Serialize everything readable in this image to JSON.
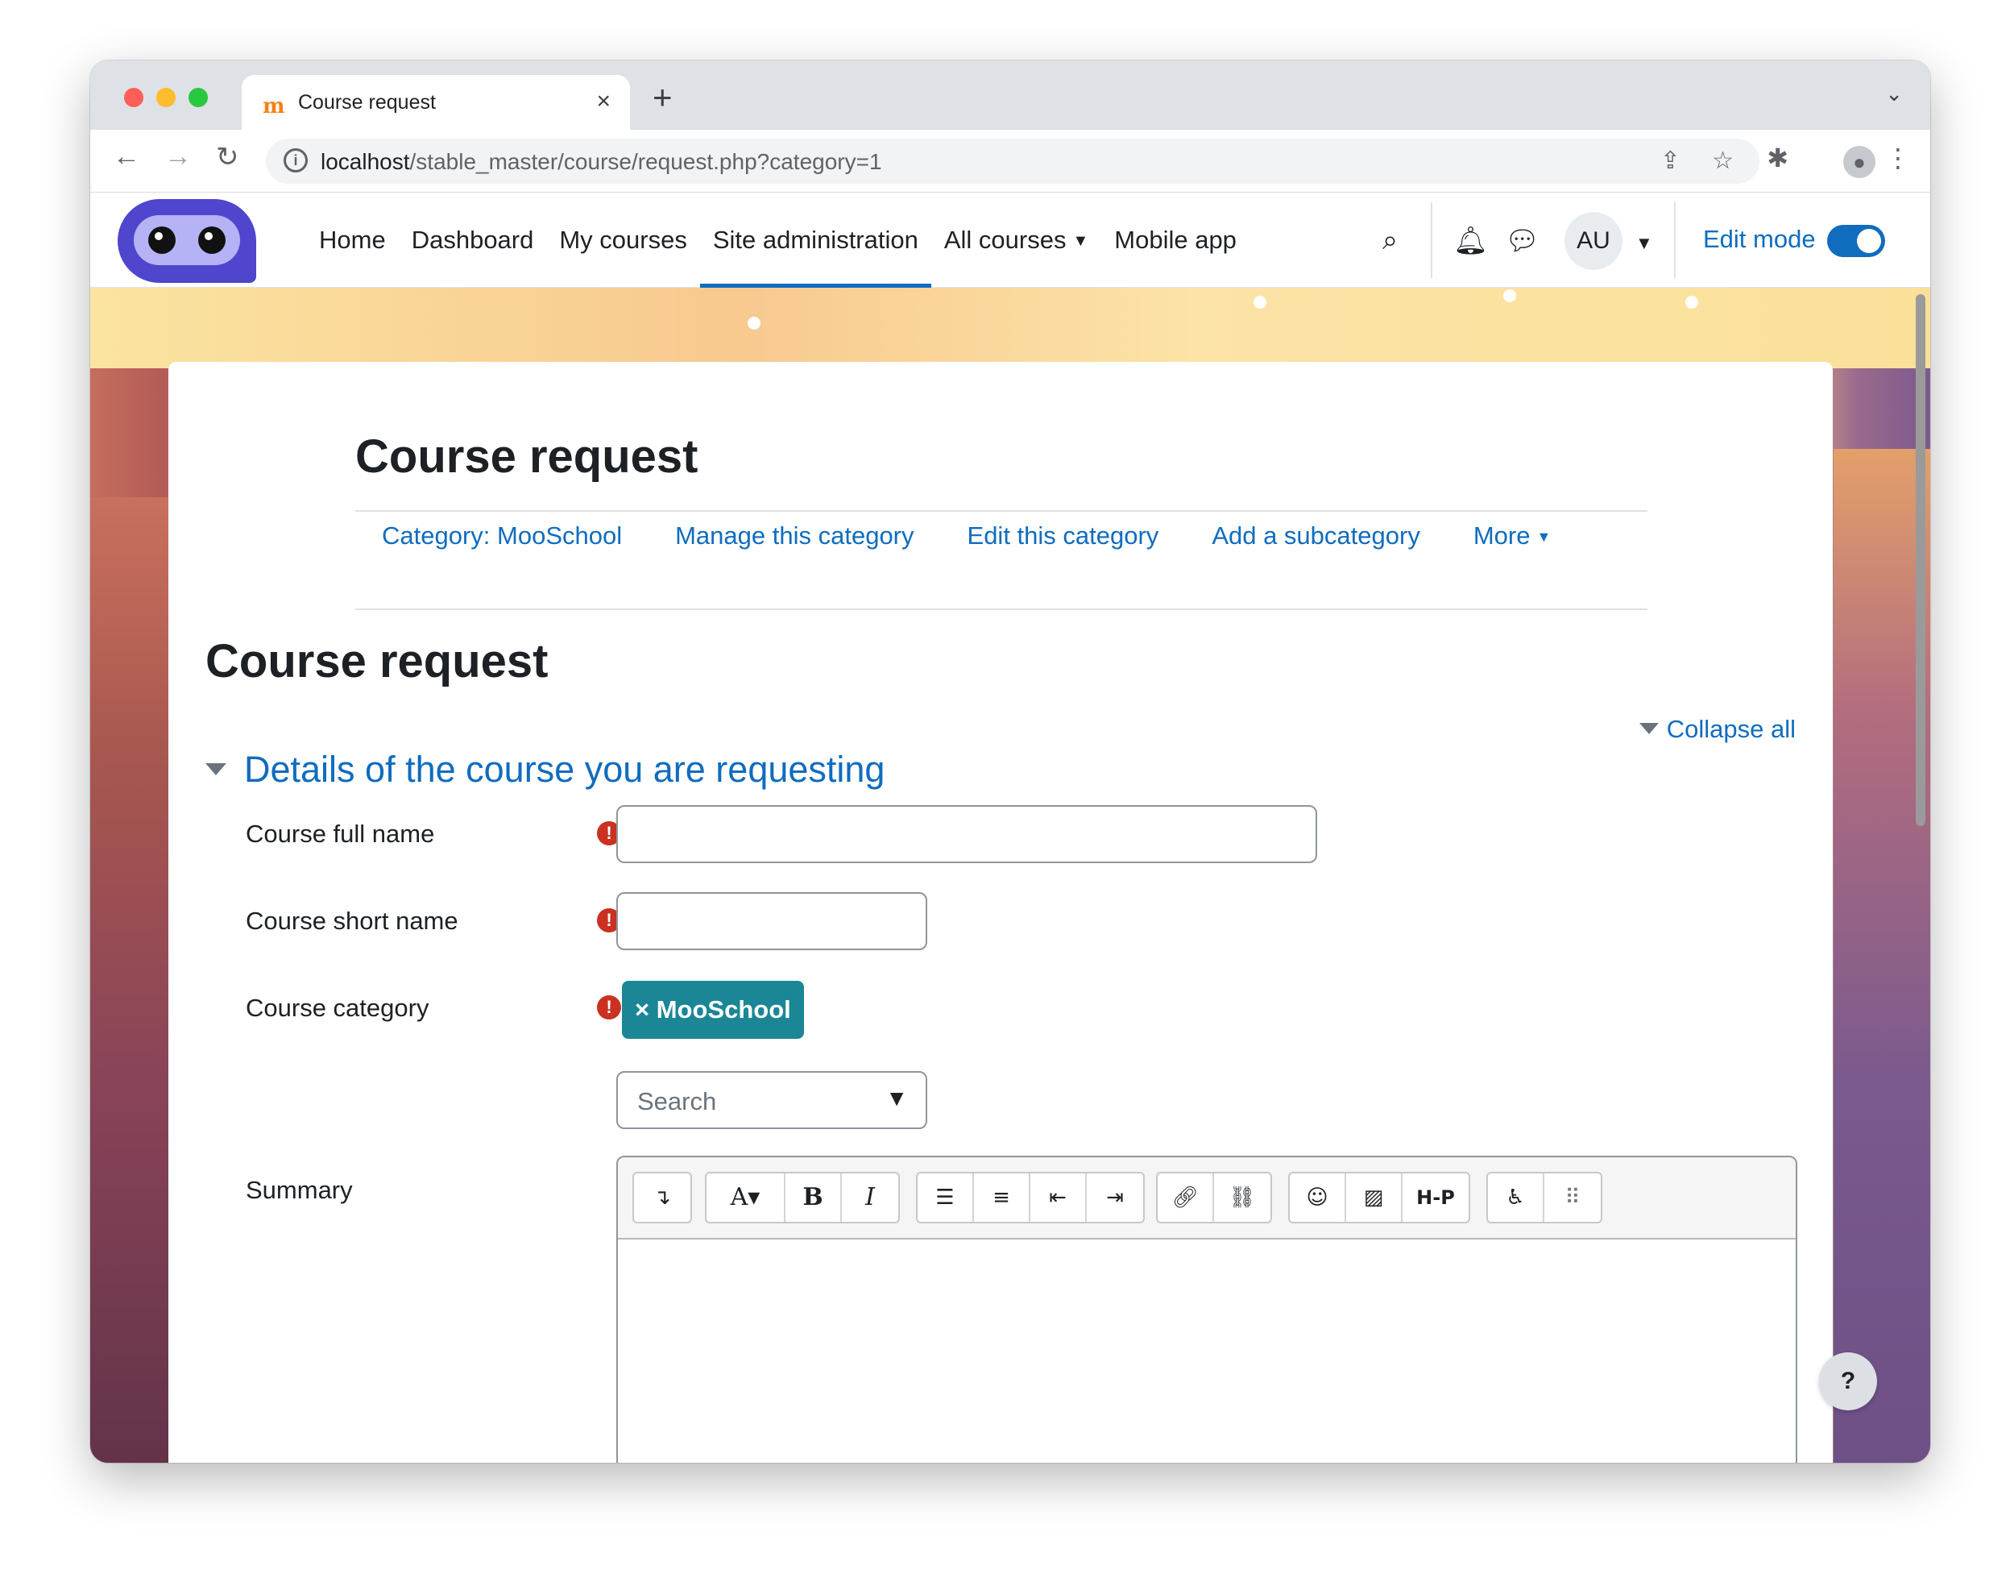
{
  "browser": {
    "tab_title": "Course request",
    "tab_favicon": "m",
    "url_host": "localhost",
    "url_path": "/stable_master/course/request.php?category=1"
  },
  "navbar": {
    "items": [
      {
        "label": "Home"
      },
      {
        "label": "Dashboard"
      },
      {
        "label": "My courses"
      },
      {
        "label": "Site administration",
        "active": true
      },
      {
        "label": "All courses",
        "dropdown": true
      },
      {
        "label": "Mobile app"
      }
    ],
    "avatar_initials": "AU",
    "edit_mode_label": "Edit mode",
    "edit_mode_on": true
  },
  "page": {
    "header_title": "Course request",
    "secondary_nav": [
      {
        "label": "Category: MooSchool"
      },
      {
        "label": "Manage this category"
      },
      {
        "label": "Edit this category"
      },
      {
        "label": "Add a subcategory"
      },
      {
        "label": "More"
      }
    ],
    "title": "Course request",
    "collapse_all": "Collapse all",
    "section_title": "Details of the course you are requesting"
  },
  "form": {
    "full_name_label": "Course full name",
    "short_name_label": "Course short name",
    "category_label": "Course category",
    "category_selected": "× MooSchool",
    "search_placeholder": "Search",
    "summary_label": "Summary"
  },
  "icons": {
    "required": "!",
    "help": "?",
    "help_fab": "?"
  },
  "colors": {
    "link": "#0f6cbf",
    "required": "#ca3120",
    "chip": "#1b8695",
    "logo": "#4f46cd"
  }
}
